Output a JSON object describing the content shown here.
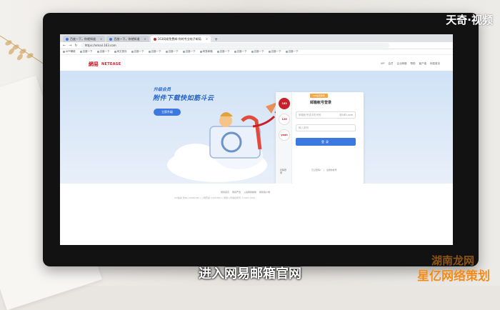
{
  "watermark": "天奇·视频",
  "caption": "进入网易邮箱官网",
  "corner_mark": {
    "line1": "湖南龙网",
    "line2": "星亿网络策划"
  },
  "colors": {
    "brand_red": "#c8202b",
    "accent_blue": "#3b78e0",
    "hero_bg": "#dfeaf8"
  },
  "browser": {
    "tabs": [
      {
        "label": "百度一下，你就知道",
        "active": false
      },
      {
        "label": "百度一下，你就知道",
        "active": false
      },
      {
        "label": "163网易免费邮-你的专业电子邮局",
        "active": true
      }
    ],
    "address": "https://email.163.com",
    "bookmarks": [
      "APP爆款",
      "百度一下",
      "百度一下",
      "网文首页",
      "百度一下",
      "百度一下",
      "百度一下",
      "百度一下",
      "网易邮箱",
      "百度一下",
      "百度一下",
      "百度一下",
      "百度一下",
      "百度一下"
    ]
  },
  "site": {
    "logo_cn": "網易",
    "logo_en": "NETEASE",
    "top_links": [
      "VIP",
      "会员",
      "企业邮箱",
      "帮助",
      "客户端",
      "网易首页"
    ]
  },
  "hero": {
    "tag": "升级会员",
    "title": "附件下载快如筋斗云",
    "button": "立即升级"
  },
  "login": {
    "tabs": [
      "163",
      "126",
      "yeah"
    ],
    "side_note": "扫码登录",
    "vip_badge": "VIP会员登录",
    "title": "邮箱帐号登录",
    "email_placeholder": "邮箱帐号或手机号码",
    "email_suffix": "@163.com",
    "password_placeholder": "输入密码",
    "submit": "登录",
    "links": [
      "忘记密码?",
      "|",
      "注册新帐号"
    ]
  },
  "footer": {
    "links": [
      "网易首页",
      "网易严选",
      "入驻网易邮箱",
      "网易客户端"
    ],
    "legal": "ICP备案 浙B2-20090185 | 公网安备 33010802 | 网易公司版权所有 ©1997-2022"
  }
}
